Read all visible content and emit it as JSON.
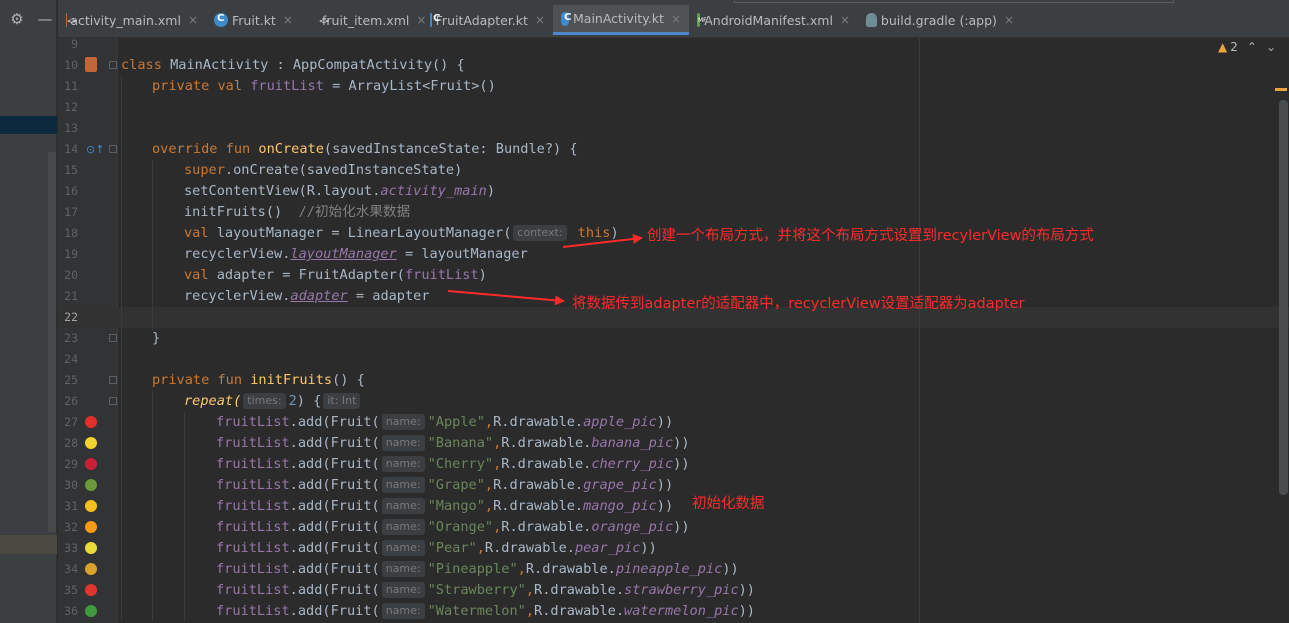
{
  "tabs": [
    {
      "label": "activity_main.xml",
      "icon": "xml-file-icon",
      "active": false
    },
    {
      "label": "Fruit.kt",
      "icon": "kotlin-class-icon",
      "active": false
    },
    {
      "label": "fruit_item.xml",
      "icon": "xml-file-icon",
      "active": false
    },
    {
      "label": "FruitAdapter.kt",
      "icon": "kotlin-class-icon",
      "active": false
    },
    {
      "label": "MainActivity.kt",
      "icon": "kotlin-class-icon",
      "active": true
    },
    {
      "label": "AndroidManifest.xml",
      "icon": "manifest-file-icon",
      "active": false
    },
    {
      "label": "build.gradle (:app)",
      "icon": "gradle-icon",
      "active": false
    }
  ],
  "close_glyph": "×",
  "toolbar": {
    "settings_glyph": "⚙",
    "minimize_glyph": "—"
  },
  "inspection": {
    "warnings": "2",
    "up_glyph": "⌃",
    "down_glyph": "⌄"
  },
  "line_numbers": [
    "9",
    "10",
    "11",
    "12",
    "13",
    "14",
    "15",
    "16",
    "17",
    "18",
    "19",
    "20",
    "21",
    "22",
    "23",
    "24",
    "25",
    "26",
    "27",
    "28",
    "29",
    "30",
    "31",
    "32",
    "33",
    "34",
    "35",
    "36"
  ],
  "current_line": "22",
  "code": {
    "l10": {
      "kw": "class",
      "name": " MainActivity : AppCompatActivity() {"
    },
    "l11": {
      "kw": "private val ",
      "prop": "fruitList",
      "rest": " = ArrayList<Fruit>()"
    },
    "l14": {
      "kw": "override fun ",
      "fn": "onCreate",
      "rest": "(savedInstanceState: Bundle?) {"
    },
    "l15": {
      "kw": "super",
      "rest": ".onCreate(savedInstanceState)"
    },
    "l16": {
      "pre": "setContentView(R.layout.",
      "prop": "activity_main",
      "post": ")"
    },
    "l17": {
      "pre": "initFruits()  ",
      "cmt": "//初始化水果数据"
    },
    "l18": {
      "kw": "val ",
      "pre": "layoutManager = LinearLayoutManager(",
      "hint": "context:",
      "kw2": " this",
      "post": ")"
    },
    "l19": {
      "pre": "recyclerView.",
      "prop": "layoutManager",
      "post": " = layoutManager"
    },
    "l20": {
      "kw": "val ",
      "pre": "adapter = FruitAdapter(",
      "prop": "fruitList",
      "post": ")"
    },
    "l21": {
      "pre": "recyclerView.",
      "prop": "adapter",
      "post": " = adapter"
    },
    "l23": {
      "pre": "}"
    },
    "l25": {
      "kw": "private fun ",
      "fn": "initFruits",
      "rest": "() {"
    },
    "l26": {
      "pre": "repeat(",
      "hint": "times:",
      "num": "2",
      "post": ") {",
      "hint2": "it: Int"
    },
    "fruits": [
      {
        "name": "\"Apple\"",
        "res": "apple_pic",
        "icon": "apple-icon",
        "color": "#e0302b"
      },
      {
        "name": "\"Banana\"",
        "res": "banana_pic",
        "icon": "banana-icon",
        "color": "#f2d22e"
      },
      {
        "name": "\"Cherry\"",
        "res": "cherry_pic",
        "icon": "cherry-icon",
        "color": "#c9203a"
      },
      {
        "name": "\"Grape\"",
        "res": "grape_pic",
        "icon": "grape-icon",
        "color": "#6c9a3b"
      },
      {
        "name": "\"Mango\"",
        "res": "mango_pic",
        "icon": "mango-icon",
        "color": "#f5c01c"
      },
      {
        "name": "\"Orange\"",
        "res": "orange_pic",
        "icon": "orange-icon",
        "color": "#f59a12"
      },
      {
        "name": "\"Pear\"",
        "res": "pear_pic",
        "icon": "pear-icon",
        "color": "#e9dc3a"
      },
      {
        "name": "\"Pineapple\"",
        "res": "pineapple_pic",
        "icon": "pineapple-icon",
        "color": "#d9a22a"
      },
      {
        "name": "\"Strawberry\"",
        "res": "strawberry_pic",
        "icon": "strawberry-icon",
        "color": "#e2352e"
      },
      {
        "name": "\"Watermelon\"",
        "res": "watermelon_pic",
        "icon": "watermelon-icon",
        "color": "#3f9a3f"
      }
    ],
    "fruit_line": {
      "prop": "fruitList",
      "pre": ".add(Fruit(",
      "hint": "name:",
      "mid": "R.drawable.",
      "post": "))",
      "comma": ","
    }
  },
  "annotations": {
    "layout_note": "创建一个布局方式，并将这个布局方式设置到recylerView的布局方式",
    "adapter_note": "将数据传到adapter的适配器中，recyclerView设置适配器为adapter",
    "init_note": "初始化数据"
  },
  "colors": {
    "annotation": "#ff2a2a",
    "editor_bg": "#2b2b2b",
    "keyword": "#cc7832",
    "string": "#6a8759"
  }
}
